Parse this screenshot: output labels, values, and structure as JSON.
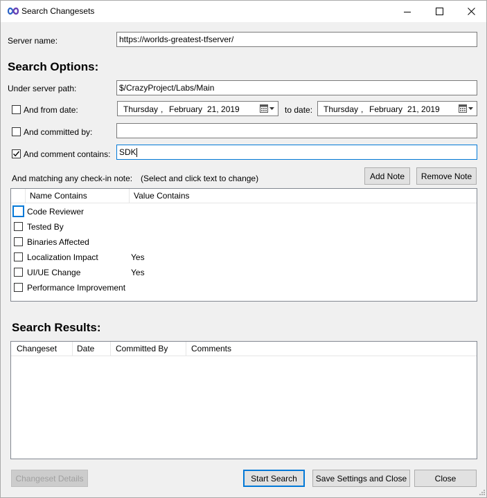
{
  "window": {
    "title": "Search Changesets",
    "icon": "infinity-icon"
  },
  "server": {
    "label": "Server name:",
    "value": "https://worlds-greatest-tfserver/"
  },
  "options": {
    "heading": "Search Options:",
    "path_label": "Under server path:",
    "path_value": "$/CrazyProject/Labs/Main",
    "from_date_label": "And from date:",
    "from_date_checked": false,
    "from_date": {
      "weekday": "Thursday",
      "sep": ",",
      "month": "February",
      "day_year": "21, 2019"
    },
    "to_date_label": "to date:",
    "to_date": {
      "weekday": "Thursday",
      "sep": ",",
      "month": "February",
      "day_year": "21, 2019"
    },
    "committed_by_label": "And committed by:",
    "committed_by_checked": false,
    "committed_by_value": "",
    "comment_label": "And comment contains:",
    "comment_checked": true,
    "comment_value": "SDK"
  },
  "notes": {
    "label": "And matching any check-in note:",
    "hint": "(Select and click text to change)",
    "add_button": "Add Note",
    "remove_button": "Remove Note",
    "columns": [
      "Name Contains",
      "Value Contains"
    ],
    "rows": [
      {
        "name": "Code Reviewer",
        "value": "",
        "checked": false,
        "focused": true
      },
      {
        "name": "Tested By",
        "value": "",
        "checked": false
      },
      {
        "name": "Binaries Affected",
        "value": "",
        "checked": false
      },
      {
        "name": "Localization Impact",
        "value": "Yes",
        "checked": false
      },
      {
        "name": "UI/UE Change",
        "value": "Yes",
        "checked": false
      },
      {
        "name": "Performance Improvement",
        "value": "",
        "checked": false
      }
    ]
  },
  "results": {
    "heading": "Search Results:",
    "columns": [
      "Changeset",
      "Date",
      "Committed By",
      "Comments"
    ]
  },
  "footer": {
    "details_button": "Changeset Details",
    "search_button": "Start Search",
    "save_button": "Save Settings and Close",
    "close_button": "Close"
  },
  "colors": {
    "accent": "#0078d7",
    "window_bg": "#f0f0f0",
    "icon_blue": "#2b63c6",
    "icon_purple": "#6a3fb5"
  }
}
